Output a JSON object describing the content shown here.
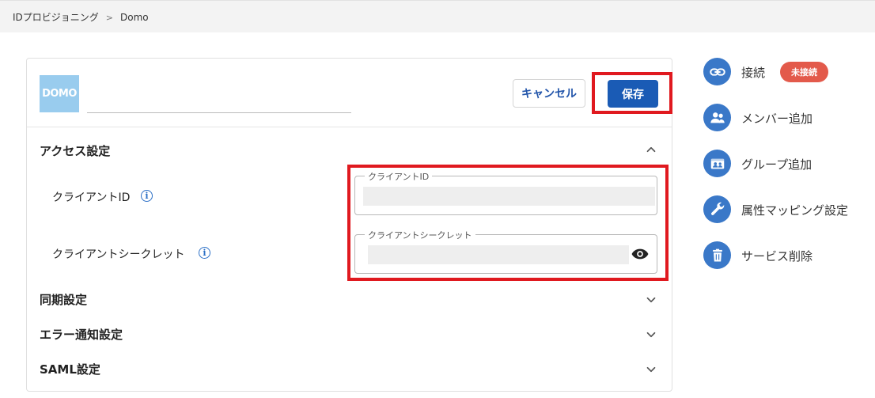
{
  "breadcrumb": {
    "root": "IDプロビジョニング",
    "separator": ">",
    "current": "Domo"
  },
  "service": {
    "logo_text": "DOMO",
    "name_value": ""
  },
  "actions": {
    "cancel_label": "キャンセル",
    "save_label": "保存"
  },
  "sections": {
    "access": {
      "title": "アクセス設定",
      "expanded": true
    },
    "sync": {
      "title": "同期設定",
      "expanded": false
    },
    "error": {
      "title": "エラー通知設定",
      "expanded": false
    },
    "saml": {
      "title": "SAML設定",
      "expanded": false
    }
  },
  "fields": {
    "client_id": {
      "label": "クライアントID",
      "legend": "クライアントID",
      "value": ""
    },
    "client_secret": {
      "label": "クライアントシークレット",
      "legend": "クライアントシークレット",
      "value": ""
    }
  },
  "sidebar": {
    "connection": {
      "label": "接続",
      "badge": "未接続",
      "icon": "link-icon"
    },
    "add_member": {
      "label": "メンバー追加",
      "icon": "people-icon"
    },
    "add_group": {
      "label": "グループ追加",
      "icon": "group-card-icon"
    },
    "attr_mapping": {
      "label": "属性マッピング設定",
      "icon": "wrench-icon"
    },
    "delete_service": {
      "label": "サービス削除",
      "icon": "trash-icon"
    }
  },
  "colors": {
    "accent": "#1a5bb5",
    "icon_bg": "#3a78c8",
    "badge_bg": "#e35a4b",
    "highlight": "#e0191f"
  }
}
